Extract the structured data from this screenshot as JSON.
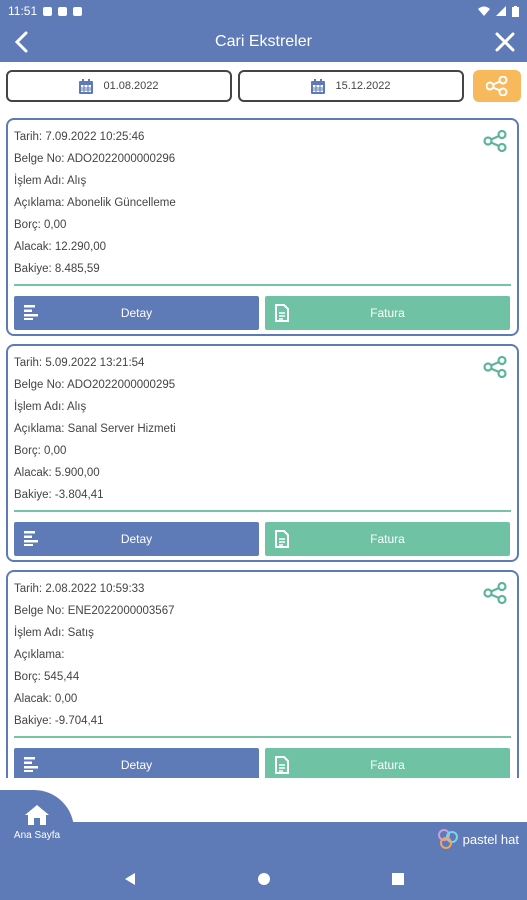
{
  "status": {
    "time": "11:51"
  },
  "header": {
    "title": "Cari Ekstreler"
  },
  "filters": {
    "start_date": "01.08.2022",
    "end_date": "15.12.2022"
  },
  "cards": [
    {
      "tarih": "Tarih: 7.09.2022 10:25:46",
      "belge": "Belge No: ADO2022000000296",
      "islem": "İşlem Adı: Alış",
      "aciklama": "Açıklama: Abonelik Güncelleme",
      "borc": "Borç: 0,00",
      "alacak": "Alacak: 12.290,00",
      "bakiye": "Bakiye: 8.485,59",
      "detay_label": "Detay",
      "fatura_label": "Fatura"
    },
    {
      "tarih": "Tarih: 5.09.2022 13:21:54",
      "belge": "Belge No: ADO2022000000295",
      "islem": "İşlem Adı: Alış",
      "aciklama": "Açıklama: Sanal Server Hizmeti",
      "borc": "Borç: 0,00",
      "alacak": "Alacak: 5.900,00",
      "bakiye": "Bakiye: -3.804,41",
      "detay_label": "Detay",
      "fatura_label": "Fatura"
    },
    {
      "tarih": "Tarih: 2.08.2022 10:59:33",
      "belge": "Belge No: ENE2022000003567",
      "islem": "İşlem Adı: Satış",
      "aciklama": "Açıklama:",
      "borc": "Borç: 545,44",
      "alacak": "Alacak: 0,00",
      "bakiye": "Bakiye: -9.704,41",
      "detay_label": "Detay",
      "fatura_label": "Fatura"
    }
  ],
  "nav": {
    "home_label": "Ana Sayfa",
    "brand": "pastel hat"
  },
  "colors": {
    "primary": "#5e7ab7",
    "accent_green": "#6fc2a4",
    "accent_orange": "#f7b95b"
  }
}
